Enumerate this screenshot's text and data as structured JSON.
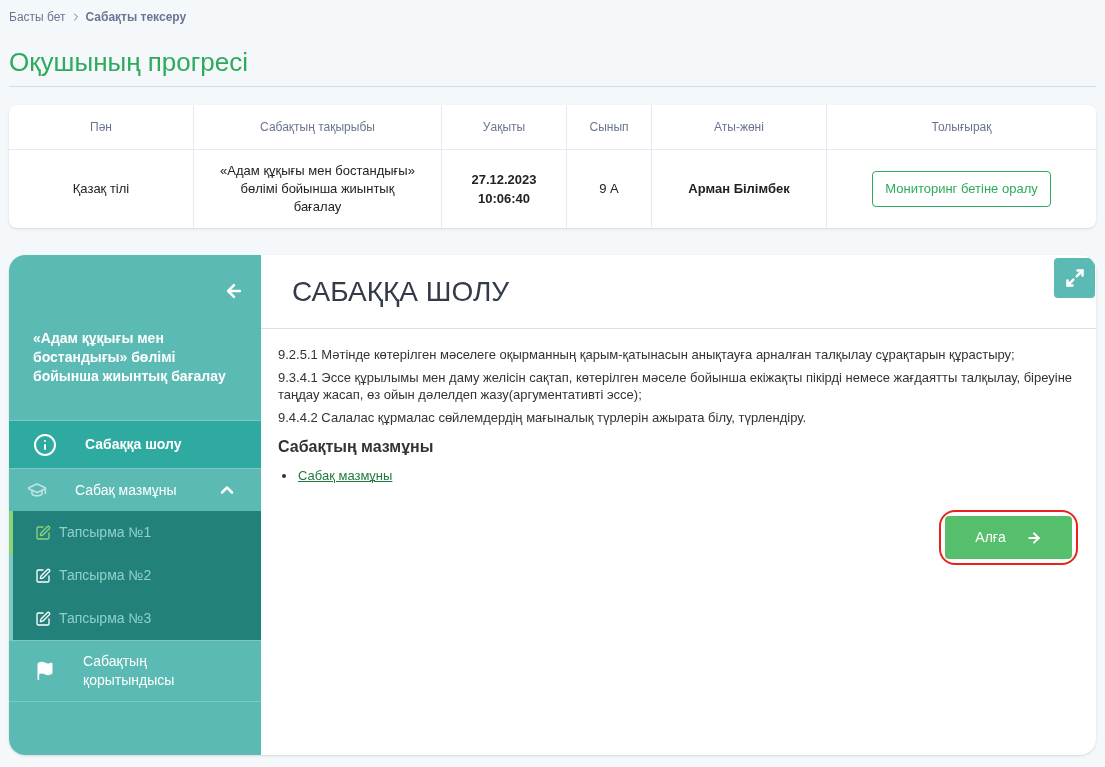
{
  "breadcrumb": [
    {
      "label": "Басты бет",
      "current": false
    },
    {
      "label": "Сабақты тексеру",
      "current": true
    }
  ],
  "page_title": "Оқушының прогресі",
  "table": {
    "columns": [
      "Пән",
      "Сабақтың тақырыбы",
      "Уақыты",
      "Сынып",
      "Аты-жөні",
      "Толығырақ"
    ],
    "rows": [
      {
        "subject": "Қазақ тілі",
        "topic": "«Адам құқығы мен бостандығы» бөлімі бойынша жиынтық бағалау",
        "time": "27.12.2023 10:06:40",
        "class": "9 А",
        "name": "Арман Білімбек",
        "action": "Мониторинг бетіне оралу"
      }
    ]
  },
  "lesson": {
    "sidebar": {
      "title": "«Адам құқығы мен бостандығы» бөлімі бойынша жиынтық бағалау",
      "items": [
        {
          "kind": "info",
          "label": "Сабаққа шолу",
          "selected": true
        },
        {
          "kind": "content",
          "label": "Сабақ мазмұны",
          "selected": false,
          "expanded": true,
          "children": [
            {
              "label": "Тапсырма №1",
              "selected": true
            },
            {
              "label": "Тапсырма №2",
              "selected": false
            },
            {
              "label": "Тапсырма №3",
              "selected": false
            }
          ]
        },
        {
          "kind": "summary",
          "label": "Сабақтың қорытындысы",
          "selected": false
        }
      ]
    },
    "heading": "САБАҚҚА ШОЛУ",
    "objectives": [
      "9.2.5.1 Мәтінде көтерілген мәселеге оқырманның қарым-қатынасын анықтауға арналған талқылау сұрақтарын құрастыру;",
      "9.3.4.1 Эссе құрылымы мен даму желісін сақтап, көтерілген мәселе бойынша екіжақты пікірді немесе жағдаятты талқылау, біреуіне таңдау жасап, өз ойын дәлелдеп жазу(аргументативті эссе);",
      "9.4.4.2 Салалас құрмалас сөйлемдердің мағыналық түрлерін ажырата білу, түрлендіру."
    ],
    "content_heading": "Сабақтың мазмұны",
    "links": [
      "Сабақ мазмұны"
    ],
    "next_button": {
      "label": "Алға",
      "highlighted": true
    }
  }
}
